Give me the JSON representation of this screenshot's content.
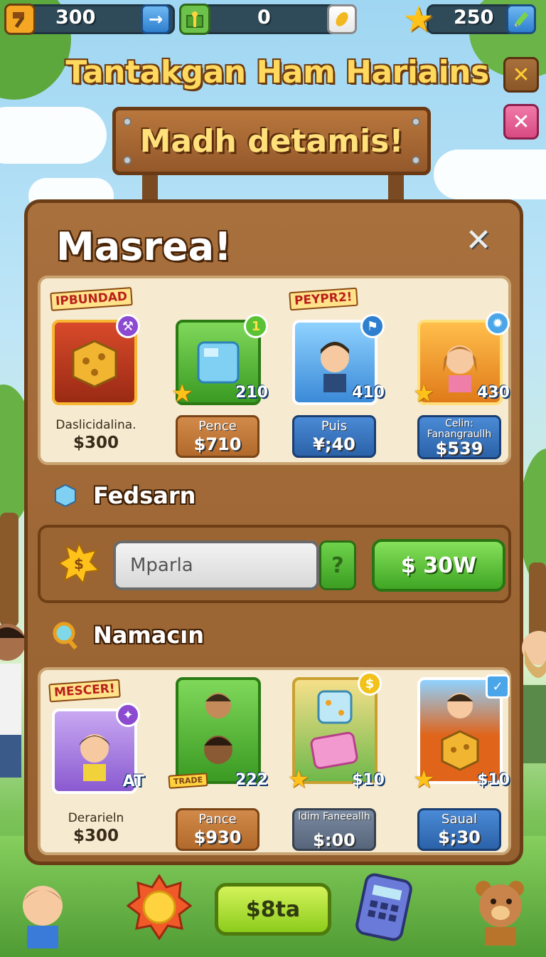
{
  "top_bar": {
    "left_resource": {
      "icon": "hammer-icon",
      "value": "300"
    },
    "left_action": {
      "icon": "arrow-right-icon",
      "glyph": "→"
    },
    "middle_resource": {
      "icon": "gift-box-icon",
      "value": "0"
    },
    "middle_action": {
      "icon": "leaf-icon"
    },
    "right_resource": {
      "icon": "star-icon",
      "value": "250"
    },
    "right_action": {
      "icon": "pencil-icon"
    }
  },
  "title": "Tantakgan Ham Hariains",
  "title_buttons": {
    "confirm": {
      "icon": "check-icon",
      "glyph": "✕"
    },
    "close": {
      "icon": "close-icon",
      "glyph": "✕"
    }
  },
  "sign_text": "Madh detamis!",
  "panel": {
    "title": "Masrea!",
    "close_glyph": "✕",
    "featured": [
      {
        "ribbon": "IPBUNDAD",
        "icon": "dice-crate-icon",
        "name": "Daslicidalina.",
        "price": "$300",
        "style": "plain"
      },
      {
        "icon": "ice-cube-icon",
        "badge": "210",
        "corner": "1",
        "tag_label": "Pence",
        "tag_price": "$710",
        "style": "brown"
      },
      {
        "ribbon": "PEYPR2!",
        "icon": "boy-avatar-icon",
        "badge": "410",
        "tag_label": "Puis",
        "tag_price": "¥;40",
        "style": "blue"
      },
      {
        "icon": "girl-avatar-icon",
        "badge": "430",
        "tag_label": "Celin: Fanangraullh",
        "tag_price": "$539",
        "style": "blue"
      }
    ],
    "section_one": {
      "title": "Fedsarn",
      "input_placeholder": "Mparla",
      "help_label": "?",
      "buy_label": "$ 30W"
    },
    "section_two": {
      "title": "Namacın",
      "items": [
        {
          "ribbon": "MESCER!",
          "icon": "girl-avatar-icon",
          "badge": "AT",
          "name": "Derarieln",
          "price": "$300",
          "style": "plain"
        },
        {
          "icon": "twins-avatar-icon",
          "badge": "222",
          "sub_label": "TRADE",
          "tag_label": "Pance",
          "tag_price": "$930",
          "style": "brown"
        },
        {
          "icon": "dice-gem-icon",
          "badge": "$10",
          "tag_label": "ldim Faneeallh",
          "tag_price": "$:00",
          "style": "gray"
        },
        {
          "icon": "boy-dice-icon",
          "badge": "$10",
          "tag_label": "Saual",
          "tag_price": "$;30",
          "style": "blue"
        }
      ]
    }
  },
  "bottom": {
    "sun_icon": "sun-badge-icon",
    "main_button": "$8ta",
    "calculator_icon": "calculator-icon"
  },
  "colors": {
    "wood": "#a8703d",
    "shelf": "#f6ead0",
    "gold_text": "#ffd85e",
    "green_button": "#3fa624",
    "blue_tag": "#2b62a8"
  }
}
